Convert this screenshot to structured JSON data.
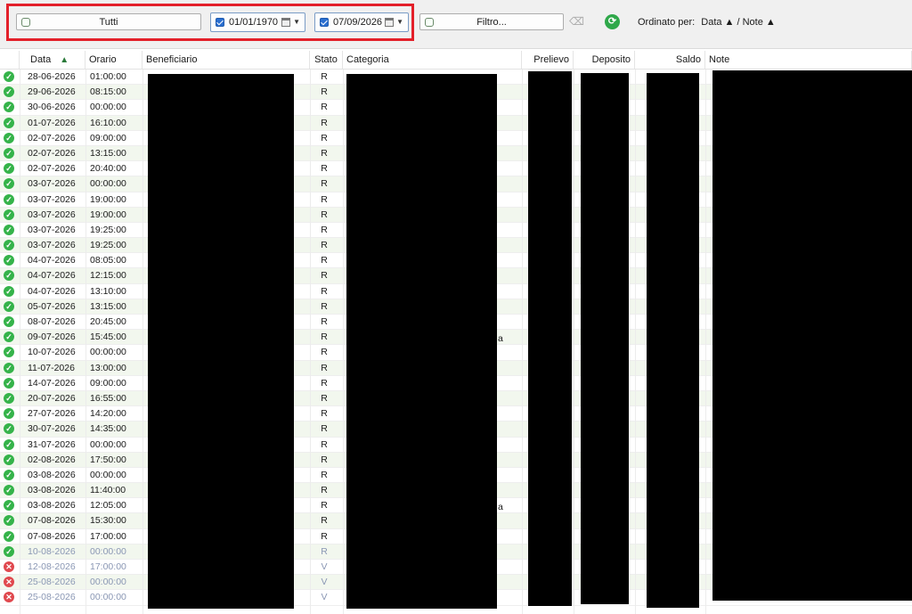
{
  "toolbar": {
    "all_label": "Tutti",
    "date_from": "01/01/1970",
    "date_to": "07/09/2026",
    "filter_label": "Filtro...",
    "sort_prefix": "Ordinato per:",
    "sort_value": "Data ▲ / Note ▲"
  },
  "columns": {
    "data": "Data",
    "orario": "Orario",
    "beneficiario": "Beneficiario",
    "stato": "Stato",
    "categoria": "Categoria",
    "prelievo": "Prelievo",
    "deposito": "Deposito",
    "saldo": "Saldo",
    "note": "Note"
  },
  "rows": [
    {
      "date": "28-06-2026",
      "time": "01:00:00",
      "stato": "R",
      "status": "ok"
    },
    {
      "date": "29-06-2026",
      "time": "08:15:00",
      "stato": "R",
      "status": "ok"
    },
    {
      "date": "30-06-2026",
      "time": "00:00:00",
      "stato": "R",
      "status": "ok"
    },
    {
      "date": "01-07-2026",
      "time": "16:10:00",
      "stato": "R",
      "status": "ok"
    },
    {
      "date": "02-07-2026",
      "time": "09:00:00",
      "stato": "R",
      "status": "ok"
    },
    {
      "date": "02-07-2026",
      "time": "13:15:00",
      "stato": "R",
      "status": "ok"
    },
    {
      "date": "02-07-2026",
      "time": "20:40:00",
      "stato": "R",
      "status": "ok"
    },
    {
      "date": "03-07-2026",
      "time": "00:00:00",
      "stato": "R",
      "status": "ok"
    },
    {
      "date": "03-07-2026",
      "time": "19:00:00",
      "stato": "R",
      "status": "ok"
    },
    {
      "date": "03-07-2026",
      "time": "19:00:00",
      "stato": "R",
      "status": "ok"
    },
    {
      "date": "03-07-2026",
      "time": "19:25:00",
      "stato": "R",
      "status": "ok"
    },
    {
      "date": "03-07-2026",
      "time": "19:25:00",
      "stato": "R",
      "status": "ok"
    },
    {
      "date": "04-07-2026",
      "time": "08:05:00",
      "stato": "R",
      "status": "ok"
    },
    {
      "date": "04-07-2026",
      "time": "12:15:00",
      "stato": "R",
      "status": "ok"
    },
    {
      "date": "04-07-2026",
      "time": "13:10:00",
      "stato": "R",
      "status": "ok"
    },
    {
      "date": "05-07-2026",
      "time": "13:15:00",
      "stato": "R",
      "status": "ok"
    },
    {
      "date": "08-07-2026",
      "time": "20:45:00",
      "stato": "R",
      "status": "ok"
    },
    {
      "date": "09-07-2026",
      "time": "15:45:00",
      "stato": "R",
      "status": "ok"
    },
    {
      "date": "10-07-2026",
      "time": "00:00:00",
      "stato": "R",
      "status": "ok"
    },
    {
      "date": "11-07-2026",
      "time": "13:00:00",
      "stato": "R",
      "status": "ok"
    },
    {
      "date": "14-07-2026",
      "time": "09:00:00",
      "stato": "R",
      "status": "ok"
    },
    {
      "date": "20-07-2026",
      "time": "16:55:00",
      "stato": "R",
      "status": "ok"
    },
    {
      "date": "27-07-2026",
      "time": "14:20:00",
      "stato": "R",
      "status": "ok"
    },
    {
      "date": "30-07-2026",
      "time": "14:35:00",
      "stato": "R",
      "status": "ok"
    },
    {
      "date": "31-07-2026",
      "time": "00:00:00",
      "stato": "R",
      "status": "ok"
    },
    {
      "date": "02-08-2026",
      "time": "17:50:00",
      "stato": "R",
      "status": "ok"
    },
    {
      "date": "03-08-2026",
      "time": "00:00:00",
      "stato": "R",
      "status": "ok"
    },
    {
      "date": "03-08-2026",
      "time": "11:40:00",
      "stato": "R",
      "status": "ok"
    },
    {
      "date": "03-08-2026",
      "time": "12:05:00",
      "stato": "R",
      "status": "ok"
    },
    {
      "date": "07-08-2026",
      "time": "15:30:00",
      "stato": "R",
      "status": "ok"
    },
    {
      "date": "07-08-2026",
      "time": "17:00:00",
      "stato": "R",
      "status": "ok"
    },
    {
      "date": "10-08-2026",
      "time": "00:00:00",
      "stato": "R",
      "status": "ok",
      "muted": true
    },
    {
      "date": "12-08-2026",
      "time": "17:00:00",
      "stato": "V",
      "status": "err",
      "muted": true
    },
    {
      "date": "25-08-2026",
      "time": "00:00:00",
      "stato": "V",
      "status": "err",
      "muted": true
    },
    {
      "date": "25-08-2026",
      "time": "00:00:00",
      "stato": "V",
      "status": "err",
      "muted": true
    }
  ],
  "colors": {
    "highlight": "#e3202a",
    "ok": "#35b34a",
    "error": "#e0484e",
    "alt_row": "#f2f7ee"
  }
}
